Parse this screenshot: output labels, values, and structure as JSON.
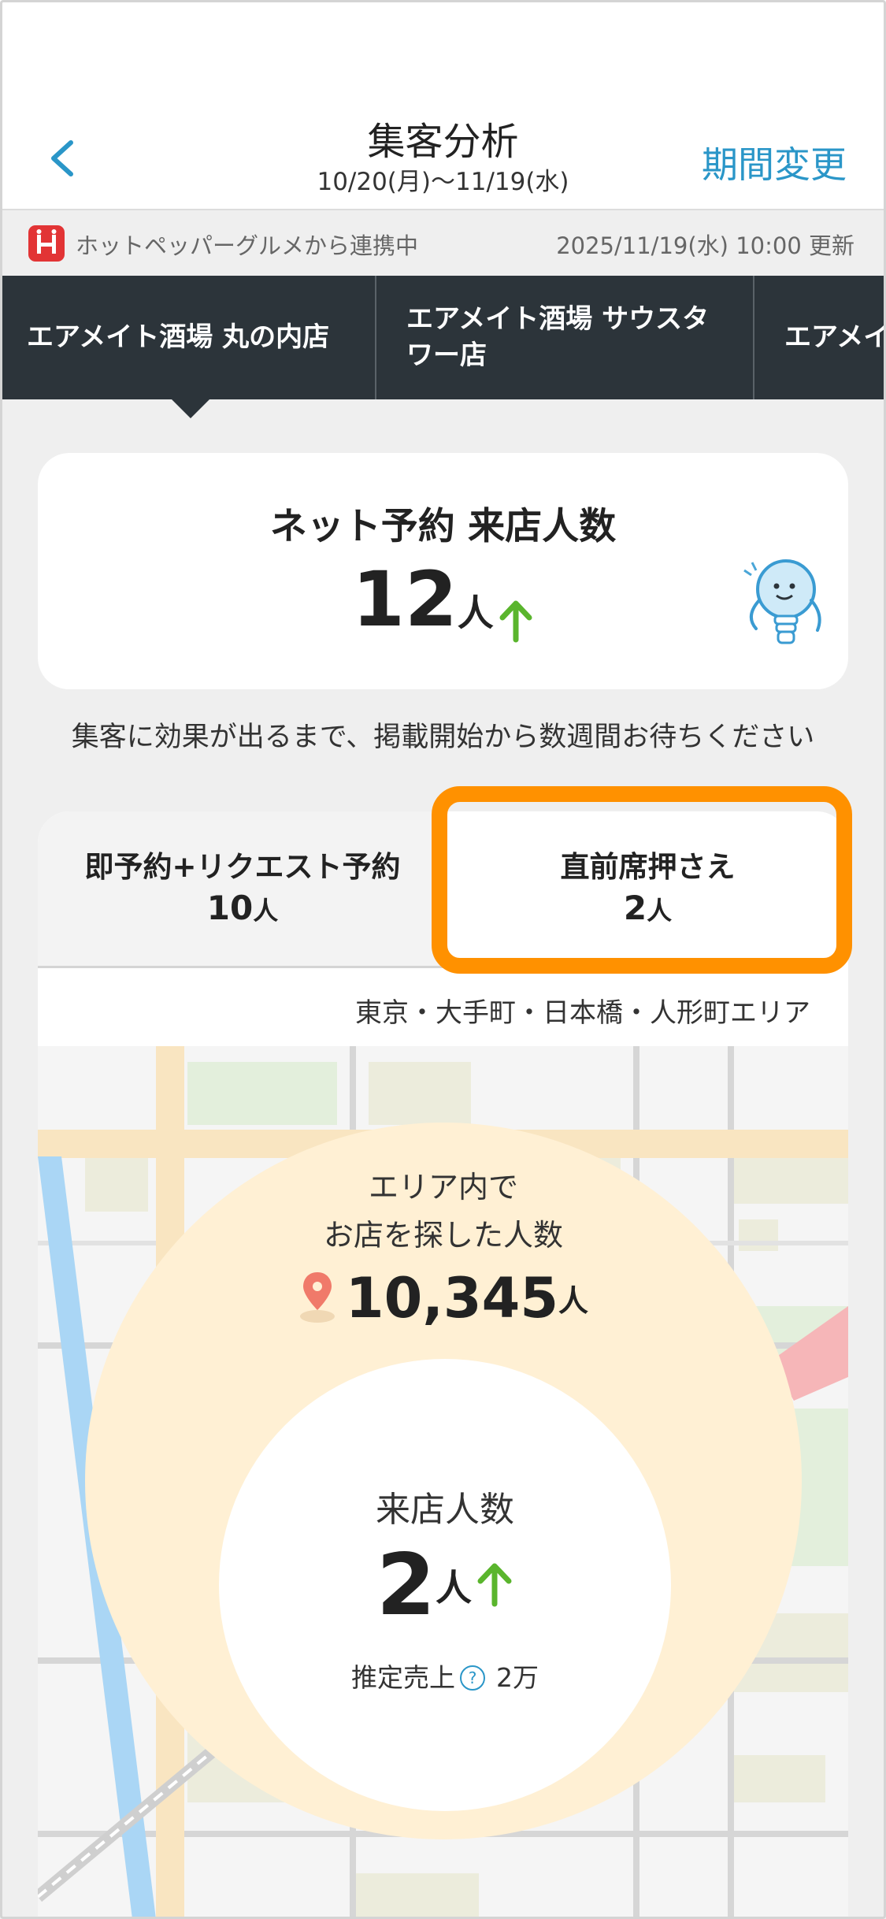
{
  "header": {
    "title": "集客分析",
    "period": "10/20(月)〜11/19(水)",
    "change_period_label": "期間変更"
  },
  "info_bar": {
    "source_label": "ホットペッパーグルメから連携中",
    "updated_label": "2025/11/19(水) 10:00 更新",
    "logo_letter": "H"
  },
  "store_tabs": [
    {
      "label": "エアメイト酒場 丸の内店",
      "selected": true
    },
    {
      "label": "エアメイト酒場 サウスタワー店",
      "selected": false
    },
    {
      "label": "エアメイ",
      "selected": false
    }
  ],
  "summary": {
    "title": "ネット予約 来店人数",
    "value": "12",
    "unit": "人",
    "trend": "up"
  },
  "notice": "集客に効果が出るまで、掲載開始から数週間お待ちください",
  "booking_tabs": {
    "instant": {
      "label": "即予約+リクエスト予約",
      "value": "10",
      "unit": "人"
    },
    "last_minute": {
      "label": "直前席押さえ",
      "value": "2",
      "unit": "人"
    }
  },
  "area": {
    "label": "東京・大手町・日本橋・人形町エリア",
    "search_label_line1": "エリア内で",
    "search_label_line2": "お店を探した人数",
    "search_count": "10,345",
    "search_unit": "人"
  },
  "visits": {
    "label": "来店人数",
    "value": "2",
    "unit": "人",
    "trend": "up",
    "sales_label": "推定売上",
    "sales_value": "2万",
    "help_glyph": "?"
  },
  "colors": {
    "accent_blue": "#2a96c8",
    "highlight_orange": "#ff9100",
    "trend_green": "#5ab52d",
    "tab_bar_dark": "#2c343a",
    "hotpepper_red": "#e23435"
  },
  "icons": {
    "back": "chevron-left-icon",
    "trend": "arrow-up-icon",
    "pin": "map-pin-icon",
    "help": "question-circle-icon",
    "mascot": "lightbulb-mascot-icon"
  }
}
